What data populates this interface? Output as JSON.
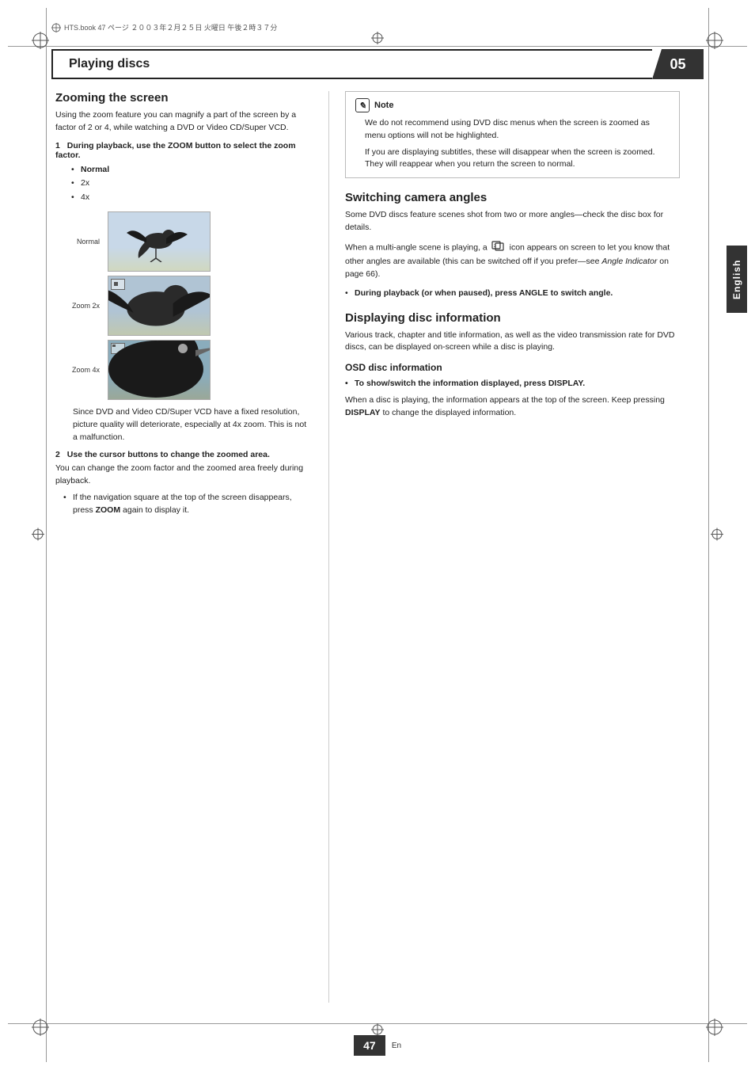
{
  "page": {
    "number": "47",
    "footer_en": "En",
    "print_header": "HTS.book  47 ページ  ２００３年２月２５日  火曜日  午後２時３７分"
  },
  "header": {
    "title": "Playing discs",
    "chapter_number": "05"
  },
  "sidebar": {
    "language_label": "English"
  },
  "left_column": {
    "section_title": "Zooming the screen",
    "intro_text": "Using the zoom feature you can magnify a part of the screen by a factor of 2 or 4, while watching a DVD or Video CD/Super VCD.",
    "step1_label": "1",
    "step1_text": "During playback, use the ZOOM button to select the zoom factor.",
    "zoom_options": [
      "Normal",
      "2x",
      "4x"
    ],
    "zoom_labels": {
      "normal": "Normal",
      "zoom2x": "Zoom 2x",
      "zoom4x": "Zoom 4x"
    },
    "note_dvd_quality": "Since DVD and Video CD/Super VCD have a fixed resolution, picture quality will deteriorate, especially at 4x zoom. This is not a malfunction.",
    "step2_label": "2",
    "step2_text": "Use the cursor buttons to change the zoomed area.",
    "step2_body": "You can change the zoom factor and the zoomed area freely during playback.",
    "step2_bullet": "If the navigation square at the top of the screen disappears, press ZOOM again to display it."
  },
  "right_column": {
    "note": {
      "title": "Note",
      "bullets": [
        "We do not recommend using DVD disc menus when the screen is zoomed as menu options will not be highlighted.",
        "If you are displaying subtitles, these will disappear when the screen is zoomed. They will reappear when you return the screen to normal."
      ]
    },
    "section2_title": "Switching camera angles",
    "section2_intro": "Some DVD discs feature scenes shot from two or more angles—check the disc box for details.",
    "section2_body": "When a multi-angle scene is playing, a",
    "section2_body2": "icon appears on screen to let you know that other angles are available (this can be switched off if you prefer—see",
    "section2_italic": "Angle Indicator",
    "section2_body3": "on page 66).",
    "step_angle_label": "•",
    "step_angle_text": "During playback (or when paused), press ANGLE to switch angle.",
    "section3_title": "Displaying disc information",
    "section3_intro": "Various track, chapter and title information, as well as the video transmission rate for DVD discs, can be displayed on-screen while a disc is playing.",
    "subsection_title": "OSD disc information",
    "display_step_label": "•",
    "display_step_text": "To show/switch the information displayed, press DISPLAY.",
    "display_body": "When a disc is playing, the information appears at the top of the screen. Keep pressing",
    "display_bold": "DISPLAY",
    "display_body2": "to change the displayed information."
  }
}
